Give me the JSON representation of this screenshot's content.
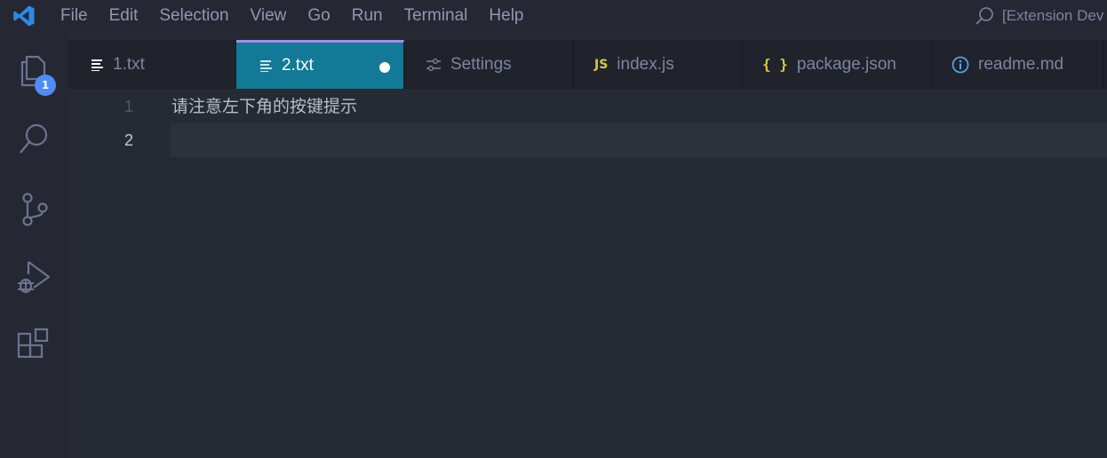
{
  "menu": [
    "File",
    "Edit",
    "Selection",
    "View",
    "Go",
    "Run",
    "Terminal",
    "Help"
  ],
  "command_center": "[Extension Dev",
  "activity": {
    "explorer_badge": "1",
    "items": [
      "explorer",
      "search",
      "source-control",
      "run-and-debug",
      "extensions"
    ]
  },
  "tabs": [
    {
      "label": "1.txt",
      "icon": "text-file-icon",
      "active": false
    },
    {
      "label": "2.txt",
      "icon": "text-file-icon",
      "active": true,
      "dirty": true
    },
    {
      "label": "Settings",
      "icon": "settings-icon",
      "active": false
    },
    {
      "label": "index.js",
      "icon": "js-icon",
      "icon_text": "JS",
      "active": false
    },
    {
      "label": "package.json",
      "icon": "json-icon",
      "icon_text": "{ }",
      "active": false
    },
    {
      "label": "readme.md",
      "icon": "info-icon",
      "active": false
    }
  ],
  "editor": {
    "lines": [
      {
        "number": "1",
        "text": "请注意左下角的按键提示"
      },
      {
        "number": "2",
        "text": ""
      }
    ]
  },
  "colors": {
    "accent_tab_bg": "#127a96",
    "accent_tab_border": "#a38cf2",
    "badge": "#4f8cf7",
    "vscode_blue": "#2b8ae8",
    "json_icon": "#d8c845"
  }
}
